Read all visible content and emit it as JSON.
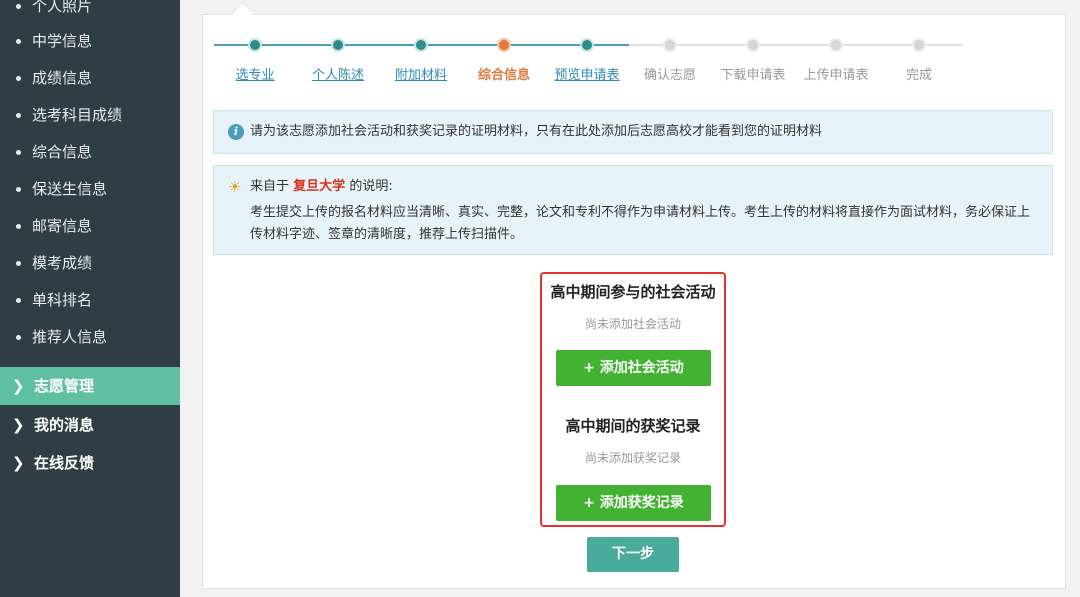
{
  "sidebar": {
    "sub_items": [
      {
        "label": "个人照片"
      },
      {
        "label": "中学信息"
      },
      {
        "label": "成绩信息"
      },
      {
        "label": "选考科目成绩"
      },
      {
        "label": "综合信息"
      },
      {
        "label": "保送生信息"
      },
      {
        "label": "邮寄信息"
      },
      {
        "label": "模考成绩"
      },
      {
        "label": "单科排名"
      },
      {
        "label": "推荐人信息"
      }
    ],
    "top_items": [
      {
        "label": "志愿管理",
        "active": true
      },
      {
        "label": "我的消息",
        "active": false
      },
      {
        "label": "在线反馈",
        "active": false
      }
    ]
  },
  "steps": [
    {
      "label": "选专业",
      "state": "done"
    },
    {
      "label": "个人陈述",
      "state": "done"
    },
    {
      "label": "附加材料",
      "state": "done"
    },
    {
      "label": "综合信息",
      "state": "current"
    },
    {
      "label": "预览申请表",
      "state": "done"
    },
    {
      "label": "确认志愿",
      "state": "pending"
    },
    {
      "label": "下载申请表",
      "state": "pending"
    },
    {
      "label": "上传申请表",
      "state": "pending"
    },
    {
      "label": "完成",
      "state": "pending"
    }
  ],
  "notice": {
    "text": "请为该志愿添加社会活动和获奖记录的证明材料，只有在此处添加后志愿高校才能看到您的证明材料"
  },
  "description": {
    "prefix": "来自于",
    "school": "复旦大学",
    "suffix": "的说明:",
    "body": "考生提交上传的报名材料应当清晰、真实、完整，论文和专利不得作为申请材料上传。考生上传的材料将直接作为面试材料，务必保证上传材料字迹、签章的清晰度，推荐上传扫描件。"
  },
  "activities": {
    "title": "高中期间参与的社会活动",
    "empty": "尚未添加社会活动",
    "button": "+ 添加社会活动"
  },
  "awards": {
    "title": "高中期间的获奖记录",
    "empty": "尚未添加获奖记录",
    "button": "+ 添加获奖记录"
  },
  "next_button": "下一步",
  "colors": {
    "sidebar_bg": "#2f3d45",
    "sidebar_active": "#5fbfa1",
    "step_done": "#2e8c8a",
    "step_current": "#e07a3c",
    "add_button": "#43b233",
    "next_button": "#4aab9c",
    "highlight_border": "#e8322b"
  }
}
